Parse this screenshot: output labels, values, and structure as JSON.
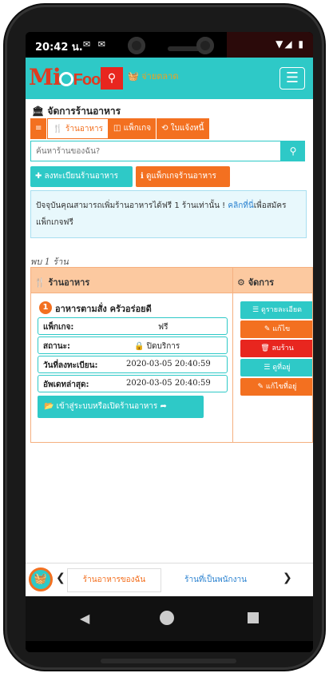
{
  "status_bar": {
    "time": "20:42 น.",
    "notification_icons": "✉ ✉",
    "system_icons": "▼◢ ▮"
  },
  "header": {
    "logo_text": "Mi",
    "logo_text_2": "Food",
    "cart_label": "จ่ายตลาด",
    "search_icon": "search-icon",
    "menu_icon": "hamburger-icon"
  },
  "page": {
    "title": "🏛 จัดการร้านอาหาร",
    "tabs": [
      {
        "label": "≡",
        "active": false
      },
      {
        "label": "🍴 ร้านอาหาร",
        "active": true
      },
      {
        "label": "◫ แพ็กเกจ",
        "active": false
      },
      {
        "label": "⟲ ใบแจ้งหนี้",
        "active": false
      }
    ],
    "search_placeholder": "ค้นหาร้านของฉัน?",
    "register_button": "✚ ลงทะเบียนร้านอาหาร",
    "packages_button": "ℹ ดูแพ็กเกจร้านอาหาร",
    "notice_text": "ปัจจุบันคุณสามารถเพิ่มร้านอาหารได้ฟรี 1 ร้านเท่านั้น ! ",
    "notice_link": "คลิกที่นี่",
    "notice_text_2": "เพื่อสมัครแพ็กเกจฟรี",
    "found_text": "พบ 1 ร้าน"
  },
  "table": {
    "col_name": "🍴 ร้านอาหาร",
    "col_manage": "⚙ จัดการ",
    "row": {
      "index": "1",
      "name": "อาหารตามสั่ง ครัวอร่อยดี",
      "fields": [
        {
          "key": "แพ็กเกจ:",
          "value": "ฟรี"
        },
        {
          "key": "สถานะ:",
          "value": "🔒 ปิดบริการ"
        },
        {
          "key": "วันที่ลงทะเบียน:",
          "value": "2020-03-05 20:40:59"
        },
        {
          "key": "อัพเดทล่าสุด:",
          "value": "2020-03-05 20:40:59"
        }
      ],
      "enter_button": "📂 เข้าสู่ระบบหรือเปิดร้านอาหาร ➦"
    },
    "actions": [
      {
        "label": "☰ ดูรายละเอียด",
        "color": "#2ec9c7"
      },
      {
        "label": "✎ แก้ไข",
        "color": "#f37020"
      },
      {
        "label": "🗑 ลบร้าน",
        "color": "#e8261f"
      },
      {
        "label": "☰ ดูที่อยู่",
        "color": "#2ec9c7"
      },
      {
        "label": "✎ แก้ไขที่อยู่",
        "color": "#f37020"
      }
    ]
  },
  "bottom_nav": {
    "prev": "❮",
    "tab_my_shops": "ร้านอาหารของฉัน",
    "tab_employee_shops": "ร้านที่เป็นพนักงาน",
    "next": "❯"
  },
  "system_nav": {
    "back": "◀"
  },
  "colors": {
    "teal": "#2ec9c7",
    "orange": "#f37020",
    "red": "#e8261f",
    "table_header": "#fcc9a0"
  }
}
